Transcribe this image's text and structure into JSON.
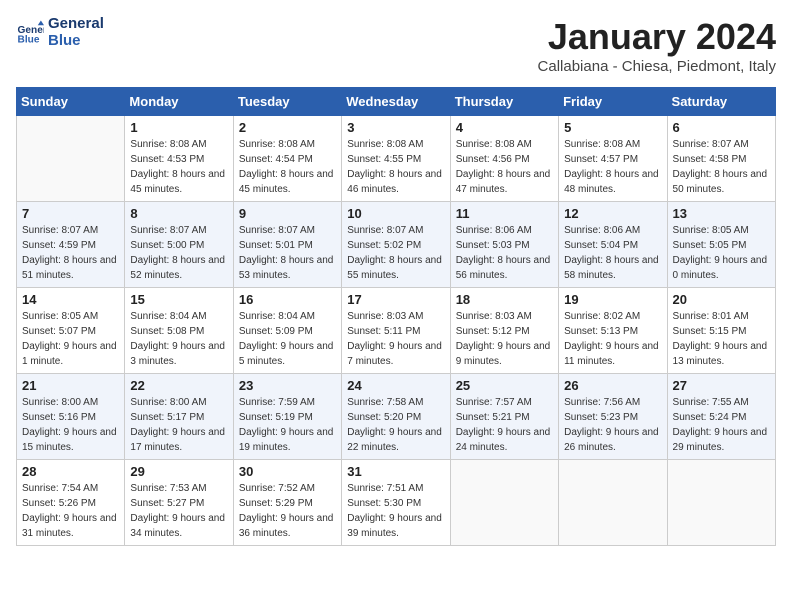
{
  "logo": {
    "line1": "General",
    "line2": "Blue"
  },
  "title": "January 2024",
  "subtitle": "Callabiana - Chiesa, Piedmont, Italy",
  "weekdays": [
    "Sunday",
    "Monday",
    "Tuesday",
    "Wednesday",
    "Thursday",
    "Friday",
    "Saturday"
  ],
  "weeks": [
    [
      {
        "day": "",
        "sunrise": "",
        "sunset": "",
        "daylight": ""
      },
      {
        "day": "1",
        "sunrise": "Sunrise: 8:08 AM",
        "sunset": "Sunset: 4:53 PM",
        "daylight": "Daylight: 8 hours and 45 minutes."
      },
      {
        "day": "2",
        "sunrise": "Sunrise: 8:08 AM",
        "sunset": "Sunset: 4:54 PM",
        "daylight": "Daylight: 8 hours and 45 minutes."
      },
      {
        "day": "3",
        "sunrise": "Sunrise: 8:08 AM",
        "sunset": "Sunset: 4:55 PM",
        "daylight": "Daylight: 8 hours and 46 minutes."
      },
      {
        "day": "4",
        "sunrise": "Sunrise: 8:08 AM",
        "sunset": "Sunset: 4:56 PM",
        "daylight": "Daylight: 8 hours and 47 minutes."
      },
      {
        "day": "5",
        "sunrise": "Sunrise: 8:08 AM",
        "sunset": "Sunset: 4:57 PM",
        "daylight": "Daylight: 8 hours and 48 minutes."
      },
      {
        "day": "6",
        "sunrise": "Sunrise: 8:07 AM",
        "sunset": "Sunset: 4:58 PM",
        "daylight": "Daylight: 8 hours and 50 minutes."
      }
    ],
    [
      {
        "day": "7",
        "sunrise": "Sunrise: 8:07 AM",
        "sunset": "Sunset: 4:59 PM",
        "daylight": "Daylight: 8 hours and 51 minutes."
      },
      {
        "day": "8",
        "sunrise": "Sunrise: 8:07 AM",
        "sunset": "Sunset: 5:00 PM",
        "daylight": "Daylight: 8 hours and 52 minutes."
      },
      {
        "day": "9",
        "sunrise": "Sunrise: 8:07 AM",
        "sunset": "Sunset: 5:01 PM",
        "daylight": "Daylight: 8 hours and 53 minutes."
      },
      {
        "day": "10",
        "sunrise": "Sunrise: 8:07 AM",
        "sunset": "Sunset: 5:02 PM",
        "daylight": "Daylight: 8 hours and 55 minutes."
      },
      {
        "day": "11",
        "sunrise": "Sunrise: 8:06 AM",
        "sunset": "Sunset: 5:03 PM",
        "daylight": "Daylight: 8 hours and 56 minutes."
      },
      {
        "day": "12",
        "sunrise": "Sunrise: 8:06 AM",
        "sunset": "Sunset: 5:04 PM",
        "daylight": "Daylight: 8 hours and 58 minutes."
      },
      {
        "day": "13",
        "sunrise": "Sunrise: 8:05 AM",
        "sunset": "Sunset: 5:05 PM",
        "daylight": "Daylight: 9 hours and 0 minutes."
      }
    ],
    [
      {
        "day": "14",
        "sunrise": "Sunrise: 8:05 AM",
        "sunset": "Sunset: 5:07 PM",
        "daylight": "Daylight: 9 hours and 1 minute."
      },
      {
        "day": "15",
        "sunrise": "Sunrise: 8:04 AM",
        "sunset": "Sunset: 5:08 PM",
        "daylight": "Daylight: 9 hours and 3 minutes."
      },
      {
        "day": "16",
        "sunrise": "Sunrise: 8:04 AM",
        "sunset": "Sunset: 5:09 PM",
        "daylight": "Daylight: 9 hours and 5 minutes."
      },
      {
        "day": "17",
        "sunrise": "Sunrise: 8:03 AM",
        "sunset": "Sunset: 5:11 PM",
        "daylight": "Daylight: 9 hours and 7 minutes."
      },
      {
        "day": "18",
        "sunrise": "Sunrise: 8:03 AM",
        "sunset": "Sunset: 5:12 PM",
        "daylight": "Daylight: 9 hours and 9 minutes."
      },
      {
        "day": "19",
        "sunrise": "Sunrise: 8:02 AM",
        "sunset": "Sunset: 5:13 PM",
        "daylight": "Daylight: 9 hours and 11 minutes."
      },
      {
        "day": "20",
        "sunrise": "Sunrise: 8:01 AM",
        "sunset": "Sunset: 5:15 PM",
        "daylight": "Daylight: 9 hours and 13 minutes."
      }
    ],
    [
      {
        "day": "21",
        "sunrise": "Sunrise: 8:00 AM",
        "sunset": "Sunset: 5:16 PM",
        "daylight": "Daylight: 9 hours and 15 minutes."
      },
      {
        "day": "22",
        "sunrise": "Sunrise: 8:00 AM",
        "sunset": "Sunset: 5:17 PM",
        "daylight": "Daylight: 9 hours and 17 minutes."
      },
      {
        "day": "23",
        "sunrise": "Sunrise: 7:59 AM",
        "sunset": "Sunset: 5:19 PM",
        "daylight": "Daylight: 9 hours and 19 minutes."
      },
      {
        "day": "24",
        "sunrise": "Sunrise: 7:58 AM",
        "sunset": "Sunset: 5:20 PM",
        "daylight": "Daylight: 9 hours and 22 minutes."
      },
      {
        "day": "25",
        "sunrise": "Sunrise: 7:57 AM",
        "sunset": "Sunset: 5:21 PM",
        "daylight": "Daylight: 9 hours and 24 minutes."
      },
      {
        "day": "26",
        "sunrise": "Sunrise: 7:56 AM",
        "sunset": "Sunset: 5:23 PM",
        "daylight": "Daylight: 9 hours and 26 minutes."
      },
      {
        "day": "27",
        "sunrise": "Sunrise: 7:55 AM",
        "sunset": "Sunset: 5:24 PM",
        "daylight": "Daylight: 9 hours and 29 minutes."
      }
    ],
    [
      {
        "day": "28",
        "sunrise": "Sunrise: 7:54 AM",
        "sunset": "Sunset: 5:26 PM",
        "daylight": "Daylight: 9 hours and 31 minutes."
      },
      {
        "day": "29",
        "sunrise": "Sunrise: 7:53 AM",
        "sunset": "Sunset: 5:27 PM",
        "daylight": "Daylight: 9 hours and 34 minutes."
      },
      {
        "day": "30",
        "sunrise": "Sunrise: 7:52 AM",
        "sunset": "Sunset: 5:29 PM",
        "daylight": "Daylight: 9 hours and 36 minutes."
      },
      {
        "day": "31",
        "sunrise": "Sunrise: 7:51 AM",
        "sunset": "Sunset: 5:30 PM",
        "daylight": "Daylight: 9 hours and 39 minutes."
      },
      {
        "day": "",
        "sunrise": "",
        "sunset": "",
        "daylight": ""
      },
      {
        "day": "",
        "sunrise": "",
        "sunset": "",
        "daylight": ""
      },
      {
        "day": "",
        "sunrise": "",
        "sunset": "",
        "daylight": ""
      }
    ]
  ]
}
